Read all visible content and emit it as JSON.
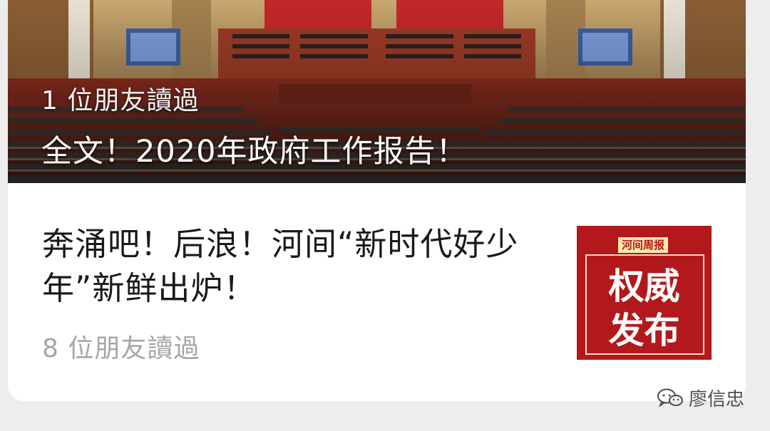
{
  "feed": {
    "featured": {
      "read_count": "1 位朋友讀過",
      "title": "全文！2020年政府工作报告！"
    },
    "article": {
      "title": "奔涌吧！后浪！河间“新时代好少年”新鲜出炉！",
      "read_count": "8 位朋友讀過",
      "thumbnail": {
        "tag": "河间周报",
        "line1": "权威",
        "line2": "发布"
      }
    }
  },
  "watermark": {
    "icon": "wechat-icon",
    "name": "廖信忠"
  },
  "colors": {
    "background": "#ededed",
    "card": "#ffffff",
    "title_text": "#1a1a1a",
    "muted_text": "#a6a6a6",
    "thumb_red": "#b3181c"
  }
}
